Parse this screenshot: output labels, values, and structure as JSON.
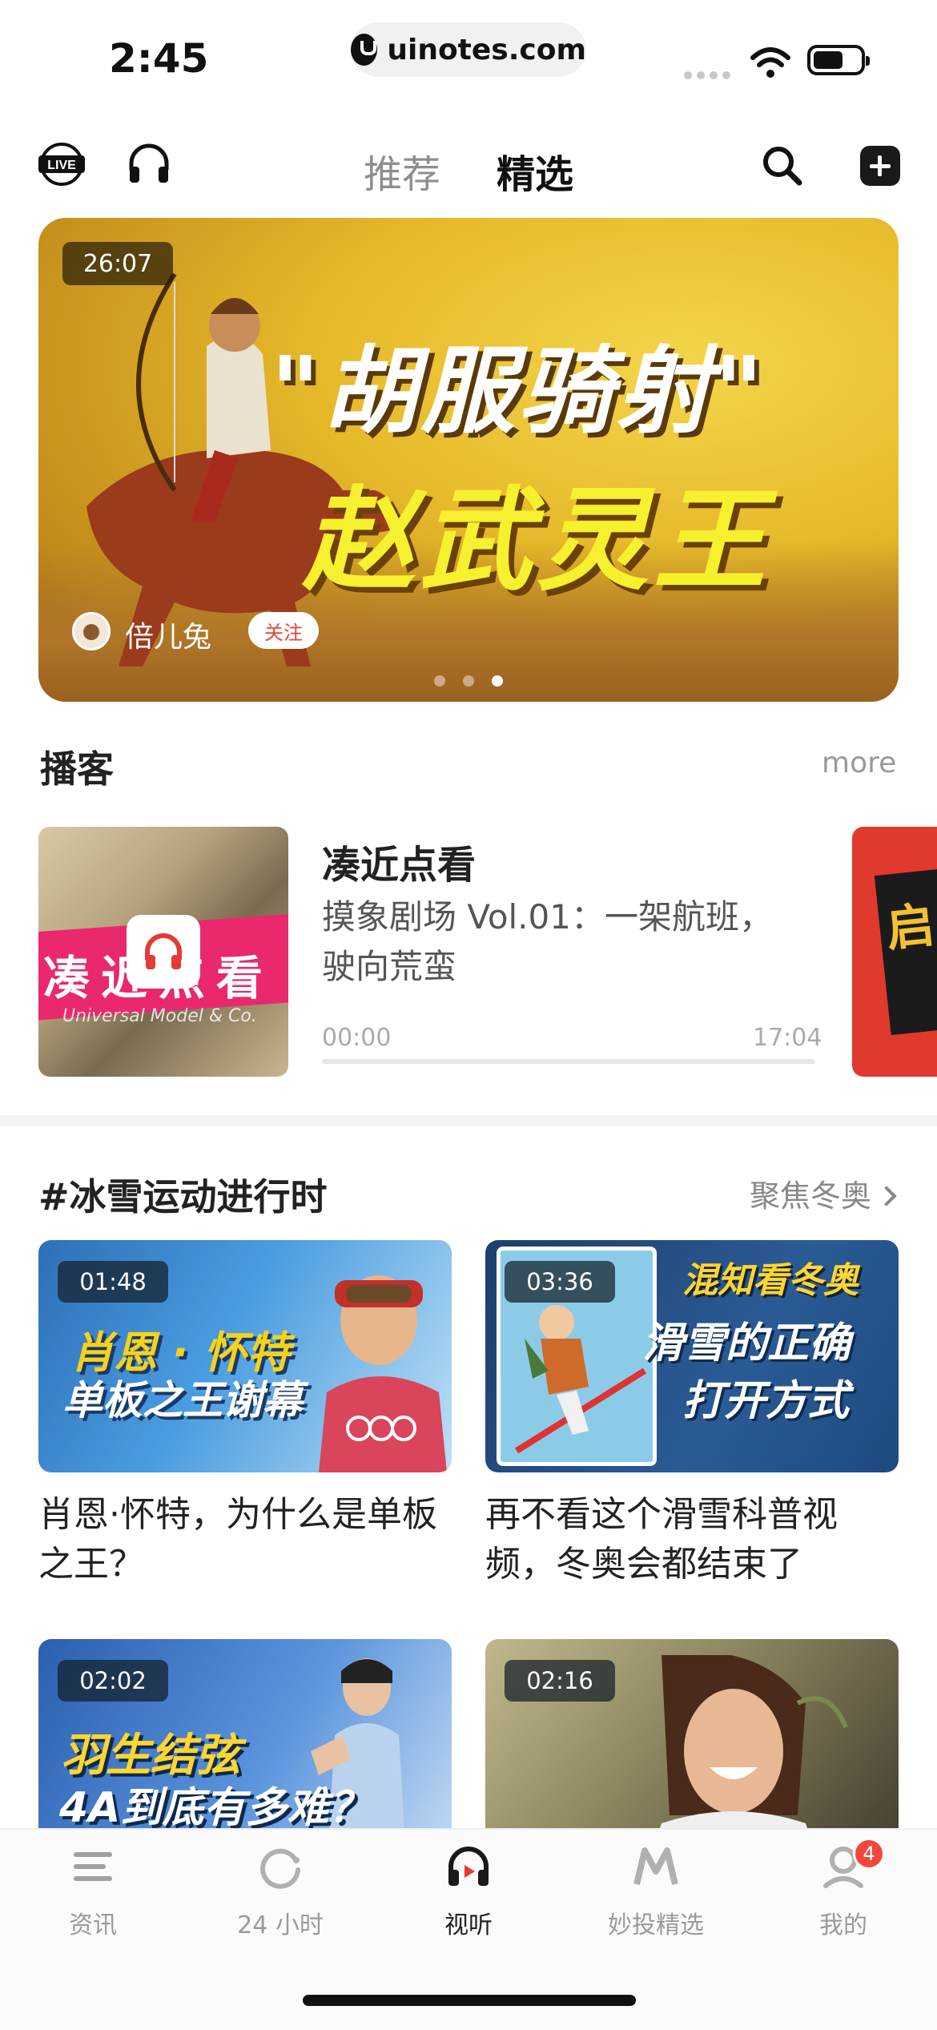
{
  "status_bar": {
    "time": "2:45",
    "url": "uinotes.com"
  },
  "top_nav": {
    "tabs": [
      {
        "label": "推荐",
        "active": false
      },
      {
        "label": "精选",
        "active": true
      }
    ]
  },
  "hero": {
    "duration": "26:07",
    "title_line1": "\"胡服骑射\"",
    "title_line2": "赵武灵王",
    "author": "倍儿兔",
    "follow_label": "关注",
    "page_count": 3,
    "active_page": 3
  },
  "podcast": {
    "section_title": "播客",
    "more_label": "more",
    "cover_text": "凑近点看",
    "cover_subtext": "Universal Model & Co.",
    "name": "凑近点看",
    "episode": "摸象剧场 Vol.01：一架航班，驶向荒蛮",
    "time_start": "00:00",
    "time_end": "17:04",
    "progress": 0,
    "next_cover_text": "启"
  },
  "winter": {
    "section_title": "#冰雪运动进行时",
    "link_label": "聚焦冬奥",
    "cards": [
      {
        "duration": "01:48",
        "thumb_line1": "肖恩 · 怀特",
        "thumb_line2": "单板之王谢幕",
        "caption": "肖恩·怀特，为什么是单板之王？"
      },
      {
        "duration": "03:36",
        "thumb_line1": "混知看冬奥",
        "thumb_line2": "滑雪的正确",
        "thumb_line3": "打开方式",
        "caption": "再不看这个滑雪科普视频，冬奥会都结束了"
      },
      {
        "duration": "02:02",
        "thumb_line1": "羽生结弦",
        "thumb_line2": "4A到底有多难？",
        "caption": ""
      },
      {
        "duration": "02:16",
        "caption": ""
      }
    ]
  },
  "tab_bar": {
    "items": [
      {
        "label": "资讯",
        "icon": "news-icon",
        "active": false
      },
      {
        "label": "24 小时",
        "icon": "refresh-icon",
        "active": false
      },
      {
        "label": "视听",
        "icon": "headphone-play-icon",
        "active": true
      },
      {
        "label": "妙投精选",
        "icon": "m-logo-icon",
        "active": false
      },
      {
        "label": "我的",
        "icon": "profile-icon",
        "active": false,
        "badge": "4"
      }
    ]
  },
  "colors": {
    "accent_red": "#e0473b",
    "badge_red": "#f2463c",
    "hero_yellow": "#f7f02e"
  }
}
